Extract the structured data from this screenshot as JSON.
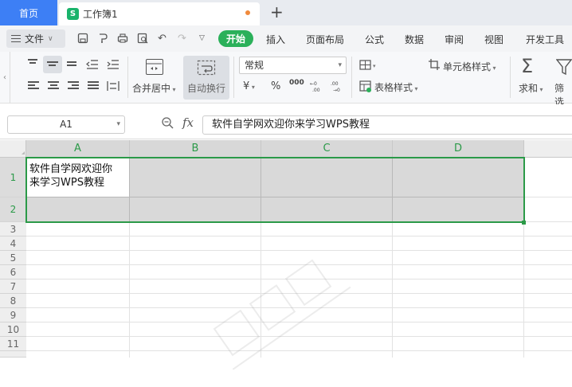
{
  "tabs": {
    "home": "首页",
    "doc": "工作簿1",
    "doc_logo": "S"
  },
  "menu": {
    "file": "文件",
    "tabs": [
      "开始",
      "插入",
      "页面布局",
      "公式",
      "数据",
      "审阅",
      "视图",
      "开发工具"
    ]
  },
  "ribbon": {
    "merge_label": "合并居中",
    "wrap_label": "自动换行",
    "number_format": "常规",
    "currency_symbol": "¥",
    "percent_symbol": "%",
    "thousands_symbol": "000",
    "cell_style": "单元格样式",
    "table_style": "表格样式",
    "sum_label": "求和",
    "filter_label": "筛选"
  },
  "formula_bar": {
    "name_box": "A1",
    "fx": "fx",
    "content": "软件自学网欢迎你来学习WPS教程"
  },
  "sheet": {
    "columns": [
      "A",
      "B",
      "C",
      "D"
    ],
    "rows": [
      "1",
      "2",
      "3",
      "4",
      "5",
      "6",
      "7",
      "8",
      "9",
      "10",
      "11"
    ],
    "a1_line1": "软件自学网欢迎你",
    "a1_line2": "来学习WPS教程"
  },
  "colors": {
    "accent_green": "#2bb05a",
    "home_tab_blue": "#3d7ff5",
    "selection_green": "#2b9a48"
  }
}
